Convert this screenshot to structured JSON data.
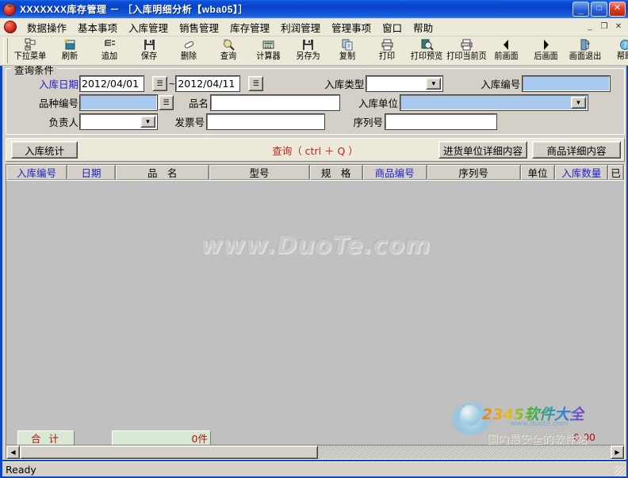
{
  "window": {
    "title": "XXXXXXX库存管理 － ［入库明细分析【wba05】］",
    "minimize": "_",
    "maximize": "□",
    "close": "✕"
  },
  "mdi_controls": {
    "minimize": "_",
    "restore": "❐",
    "close": "✕"
  },
  "menu": {
    "items": [
      {
        "label": "数据操作"
      },
      {
        "label": "基本事项"
      },
      {
        "label": "入库管理"
      },
      {
        "label": "销售管理"
      },
      {
        "label": "库存管理"
      },
      {
        "label": "利润管理"
      },
      {
        "label": "管理事项"
      },
      {
        "label": "窗口"
      },
      {
        "label": "帮助"
      }
    ]
  },
  "toolbar": {
    "buttons": [
      {
        "label": "下拉菜单",
        "icon": "dropdown-menu-icon"
      },
      {
        "label": "刷新",
        "icon": "refresh-icon"
      },
      {
        "label": "追加",
        "icon": "append-icon"
      },
      {
        "label": "保存",
        "icon": "save-floppy-icon"
      },
      {
        "label": "删除",
        "icon": "delete-eraser-icon"
      },
      {
        "label": "查询",
        "icon": "search-icon"
      },
      {
        "label": "计算器",
        "icon": "calculator-icon"
      },
      {
        "label": "另存为",
        "icon": "save-as-icon"
      },
      {
        "label": "复制",
        "icon": "copy-icon"
      },
      {
        "label": "打印",
        "icon": "print-icon"
      },
      {
        "label": "打印预览",
        "icon": "print-preview-icon"
      },
      {
        "label": "打印当前页",
        "icon": "print-current-page-icon"
      },
      {
        "label": "前画面",
        "icon": "prev-arrow-icon"
      },
      {
        "label": "后画面",
        "icon": "next-arrow-icon"
      },
      {
        "label": "画面退出",
        "icon": "exit-door-icon"
      },
      {
        "label": "帮助",
        "icon": "help-icon"
      }
    ]
  },
  "query_panel": {
    "legend": "查询条件",
    "fields": {
      "date_label": "入库日期",
      "date_from": "2012/04/01",
      "date_to": "2012/04/11",
      "date_separator": "~",
      "picker_glyph": "☰",
      "instock_type_label": "入库类型",
      "instock_type_value": "",
      "instock_no_label": "入库编号",
      "instock_no_value": "",
      "variety_no_label": "品种编号",
      "variety_no_value": "",
      "product_name_label": "品名",
      "product_name_value": "",
      "instock_unit_label": "入库单位",
      "instock_unit_value": "",
      "manager_label": "负责人",
      "manager_value": "",
      "invoice_no_label": "发票号",
      "invoice_no_value": "",
      "serial_no_label": "序列号",
      "serial_no_value": "",
      "arrow_glyph": "▼"
    }
  },
  "action_bar": {
    "stat_button": "入库统计",
    "query_hint": "查询（ ctrl ＋ Q ）",
    "supplier_detail_button": "进货单位详细内容",
    "product_detail_button": "商品详细内容"
  },
  "grid": {
    "columns": [
      {
        "label": "入库编号",
        "width": 78,
        "blue": true
      },
      {
        "label": "日期",
        "width": 62,
        "blue": true
      },
      {
        "label": "品　名",
        "width": 120,
        "blue": false
      },
      {
        "label": "型号",
        "width": 128,
        "blue": false
      },
      {
        "label": "规　格",
        "width": 68,
        "blue": false
      },
      {
        "label": "商品编号",
        "width": 82,
        "blue": true
      },
      {
        "label": "序列号",
        "width": 120,
        "blue": false
      },
      {
        "label": "单位",
        "width": 44,
        "blue": false
      },
      {
        "label": "入库数量",
        "width": 68,
        "blue": true
      },
      {
        "label": "已",
        "width": 20,
        "blue": false
      }
    ],
    "rows": [],
    "watermark": "www.DuoTe.com"
  },
  "totals": {
    "label": "合 计",
    "qty": "0件",
    "amount": "0.00"
  },
  "scrollbar": {
    "left_arrow": "◀",
    "right_arrow": "▶"
  },
  "statusbar": {
    "text": "Ready"
  },
  "brand_watermark": {
    "line1": "2345软件大全",
    "line2": "www.duote.com",
    "line3": "国内最安全的软件站"
  },
  "colors": {
    "title_blue": "#0842c8",
    "face": "#d4d0c8",
    "menu_face": "#ece9d8",
    "highlight_field": "#a9c9ef",
    "label_blue": "#2020d0",
    "hint_red": "#c02020",
    "total_green": "#d9e8d2",
    "grid_bg": "#c0c0c0"
  }
}
